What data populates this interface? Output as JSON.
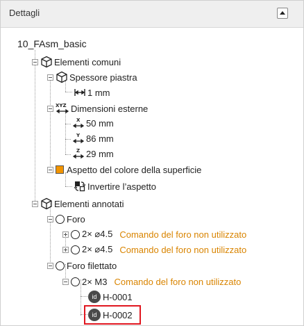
{
  "panel": {
    "title": "Dettagli",
    "collapse_icon": "triangle-up-icon"
  },
  "tree": {
    "root": "10_FAsm_basic",
    "common": {
      "label": "Elementi comuni",
      "thickness": {
        "label": "Spessore piastra",
        "value": "1 mm"
      },
      "dimensions": {
        "label": "Dimensioni esterne",
        "x": "50 mm",
        "y": "86 mm",
        "z": "29 mm"
      },
      "appearance": {
        "label": "Aspetto del colore della superficie",
        "color": "#f29400",
        "invert": "Invertire l’aspetto"
      }
    },
    "annotated": {
      "label": "Elementi annotati",
      "hole": {
        "label": "Foro",
        "items": [
          {
            "text": "2× ⌀4.5",
            "warning": "Comando del foro non utilizzato"
          },
          {
            "text": "2× ⌀4.5",
            "warning": "Comando del foro non utilizzato"
          }
        ]
      },
      "threaded": {
        "label": "Foro filettato",
        "item": {
          "text": "2× M3",
          "warning": "Comando del foro non utilizzato"
        },
        "ids": [
          "H-0001",
          "H-0002"
        ],
        "id_badge": "id"
      }
    }
  },
  "colors": {
    "warning": "#d98400",
    "highlight": "#e0161f"
  }
}
